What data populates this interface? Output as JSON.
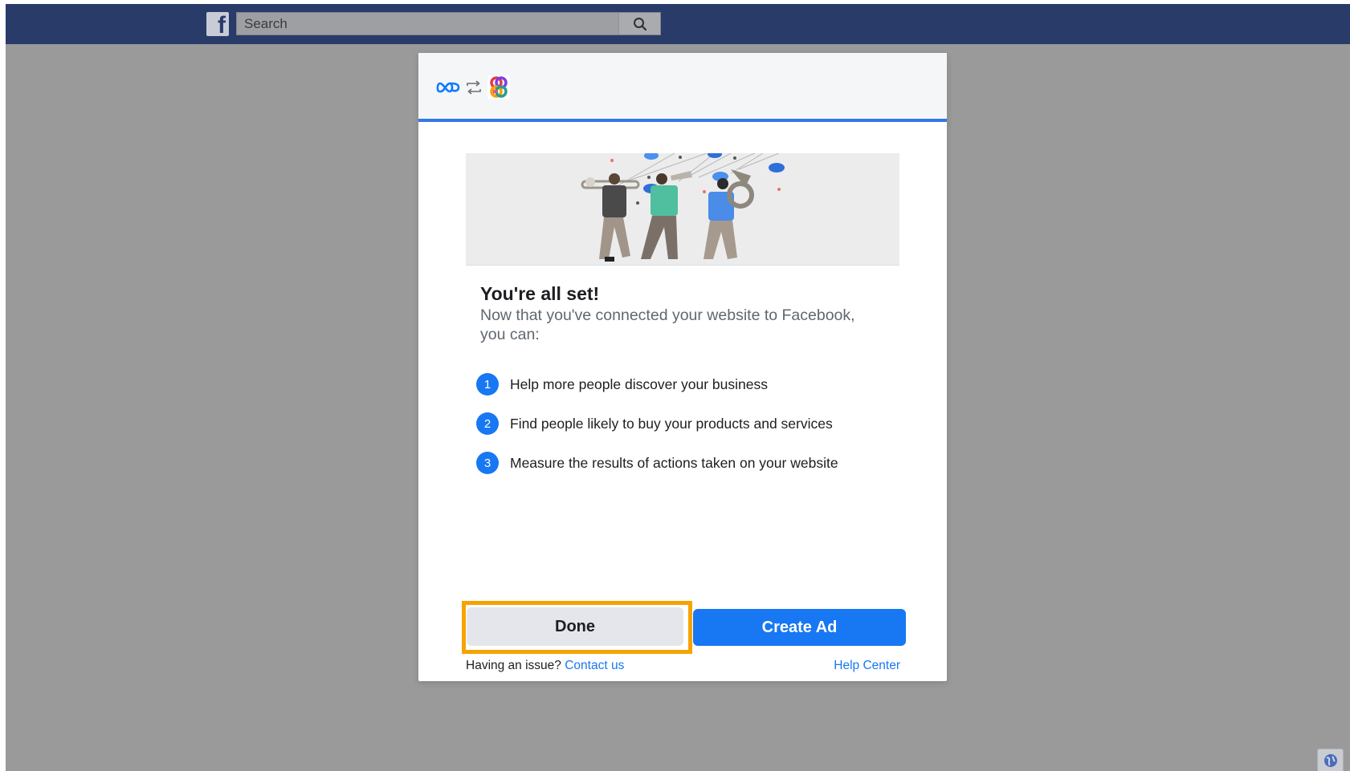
{
  "topbar": {
    "logo_letter": "f",
    "search": {
      "placeholder": "Search",
      "value": ""
    },
    "search_icon": "search-icon"
  },
  "modal": {
    "header_icons": [
      "meta-infinity-icon",
      "sync-arrows-icon",
      "partner-app-icon"
    ],
    "title": "You're all set!",
    "subtitle": "Now that you've connected your website to Facebook, you can:",
    "benefits": [
      {
        "number": "1",
        "text": "Help more people discover your business"
      },
      {
        "number": "2",
        "text": "Find people likely to buy your products and services"
      },
      {
        "number": "3",
        "text": "Measure the results of actions taken on your website"
      }
    ],
    "buttons": {
      "done": "Done",
      "create_ad": "Create Ad"
    },
    "footer": {
      "issue_text": "Having an issue?",
      "contact_link": "Contact us",
      "help_link": "Help Center"
    }
  },
  "colors": {
    "topbar": "#283b69",
    "overlay": "#9a9a9a",
    "accent_blue": "#1877f2",
    "header_bar": "#3578e5",
    "highlight_outline": "#f5a300"
  },
  "corner_icon": "globe-icon"
}
